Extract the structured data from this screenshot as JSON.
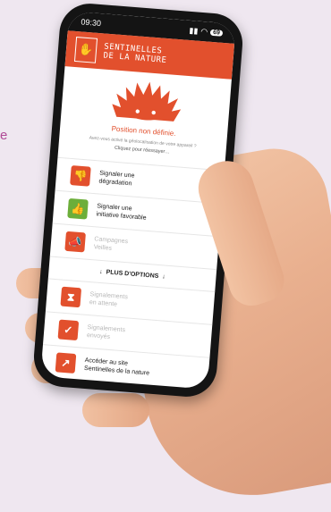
{
  "background": {
    "accent_text": "e"
  },
  "status": {
    "time": "09:30",
    "battery": "69"
  },
  "header": {
    "title_line1": "SENTINELLES",
    "title_line2": "DE LA NATURE"
  },
  "hero": {
    "title": "Position non définie.",
    "subtitle": "Avez-vous activé la géolocalisation de votre appareil ?",
    "click_label": "Cliquez pour réessayer…"
  },
  "menu": {
    "items": [
      {
        "line1": "Signaler une",
        "line2": "dégradation",
        "icon": "thumbs-down-icon",
        "color": "#e2502d",
        "enabled": true
      },
      {
        "line1": "Signaler une",
        "line2": "initiative favorable",
        "icon": "thumbs-up-icon",
        "color": "#6cae3a",
        "enabled": true
      },
      {
        "line1": "Campagnes",
        "line2": "Veilles",
        "icon": "megaphone-icon",
        "color": "#e2502d",
        "enabled": false
      }
    ],
    "more_options": "PLUS D'OPTIONS",
    "items2": [
      {
        "line1": "Signalements",
        "line2": "en attente",
        "icon": "hourglass-icon",
        "color": "#e2502d",
        "enabled": false
      },
      {
        "line1": "Signalements",
        "line2": "envoyés",
        "icon": "check-icon",
        "color": "#e2502d",
        "enabled": false
      },
      {
        "line1": "Accéder au site",
        "line2": "Sentinelles de la nature",
        "icon": "external-link-icon",
        "color": "#e2502d",
        "enabled": true
      }
    ]
  }
}
